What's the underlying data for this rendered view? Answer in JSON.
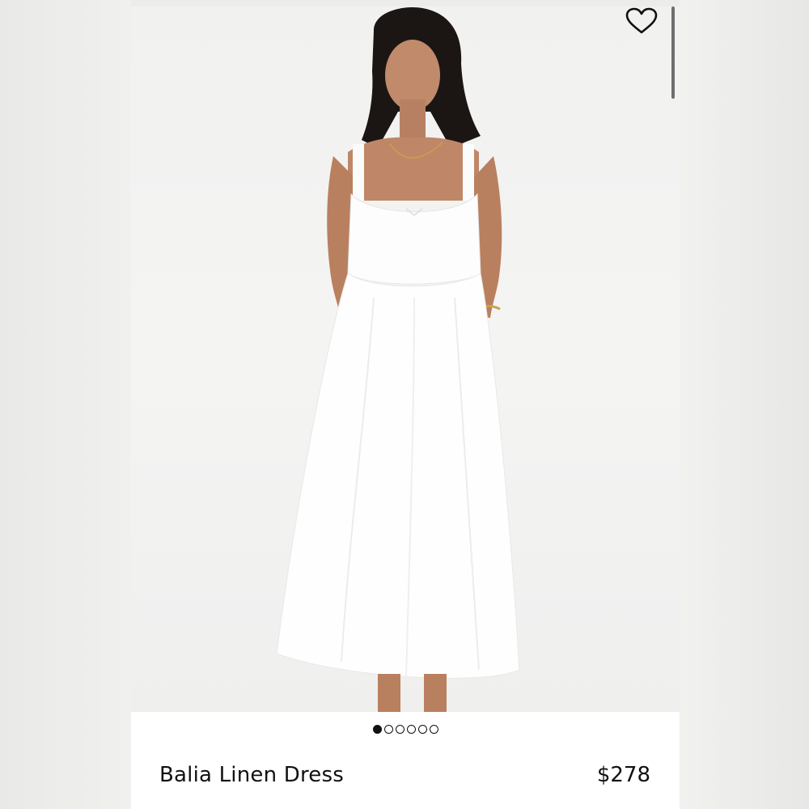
{
  "product": {
    "name": "Balia Linen Dress",
    "price": "$278",
    "image_icon": "product-photo"
  },
  "gallery": {
    "total_images": 6,
    "active_index": 0
  },
  "icons": {
    "favorite": "heart-outline-icon"
  },
  "colors": {
    "dot_active": "#111111",
    "background": "#ffffff"
  }
}
